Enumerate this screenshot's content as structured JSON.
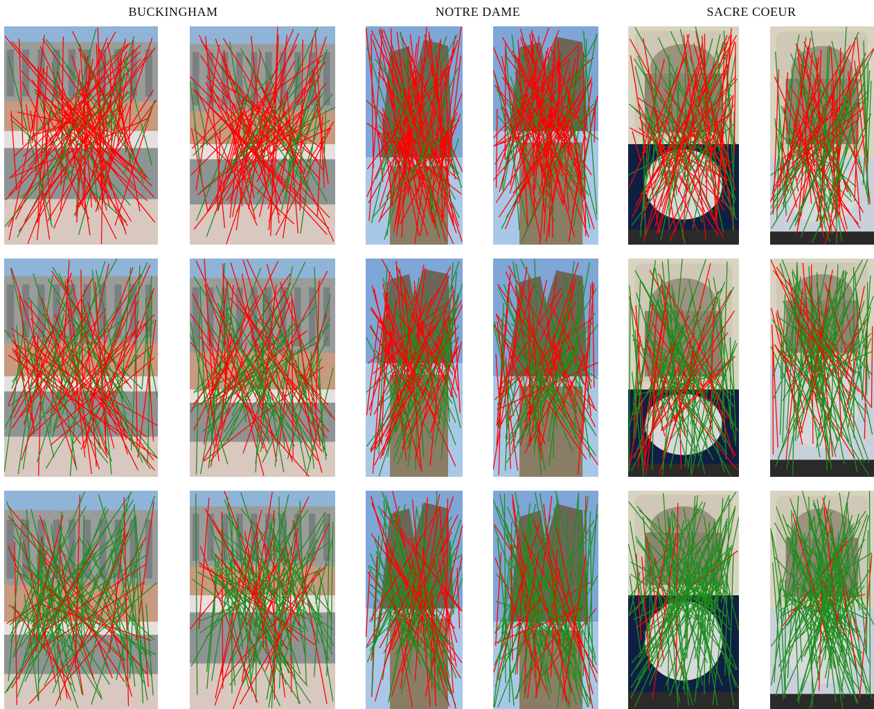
{
  "headings": [
    {
      "id": "buckingham",
      "text": "BUCKINGHAM"
    },
    {
      "id": "notre-dame",
      "text": "NOTRE DAME"
    },
    {
      "id": "sacre-coeur",
      "text": "SACRE COEUR"
    }
  ],
  "colors": {
    "inlier": "#1e8c1e",
    "outlier": "#ff0000"
  },
  "scenes": [
    {
      "id": "buckingham",
      "description_icon": "palace-photo-pair",
      "pairs_per_row": 2
    },
    {
      "id": "notre-dame",
      "description_icon": "cathedral-photo-pair",
      "pairs_per_row": 2
    },
    {
      "id": "sacre-coeur",
      "description_icon": "basilica-photo-pair",
      "pairs_per_row": 2
    }
  ],
  "rows": 3
}
